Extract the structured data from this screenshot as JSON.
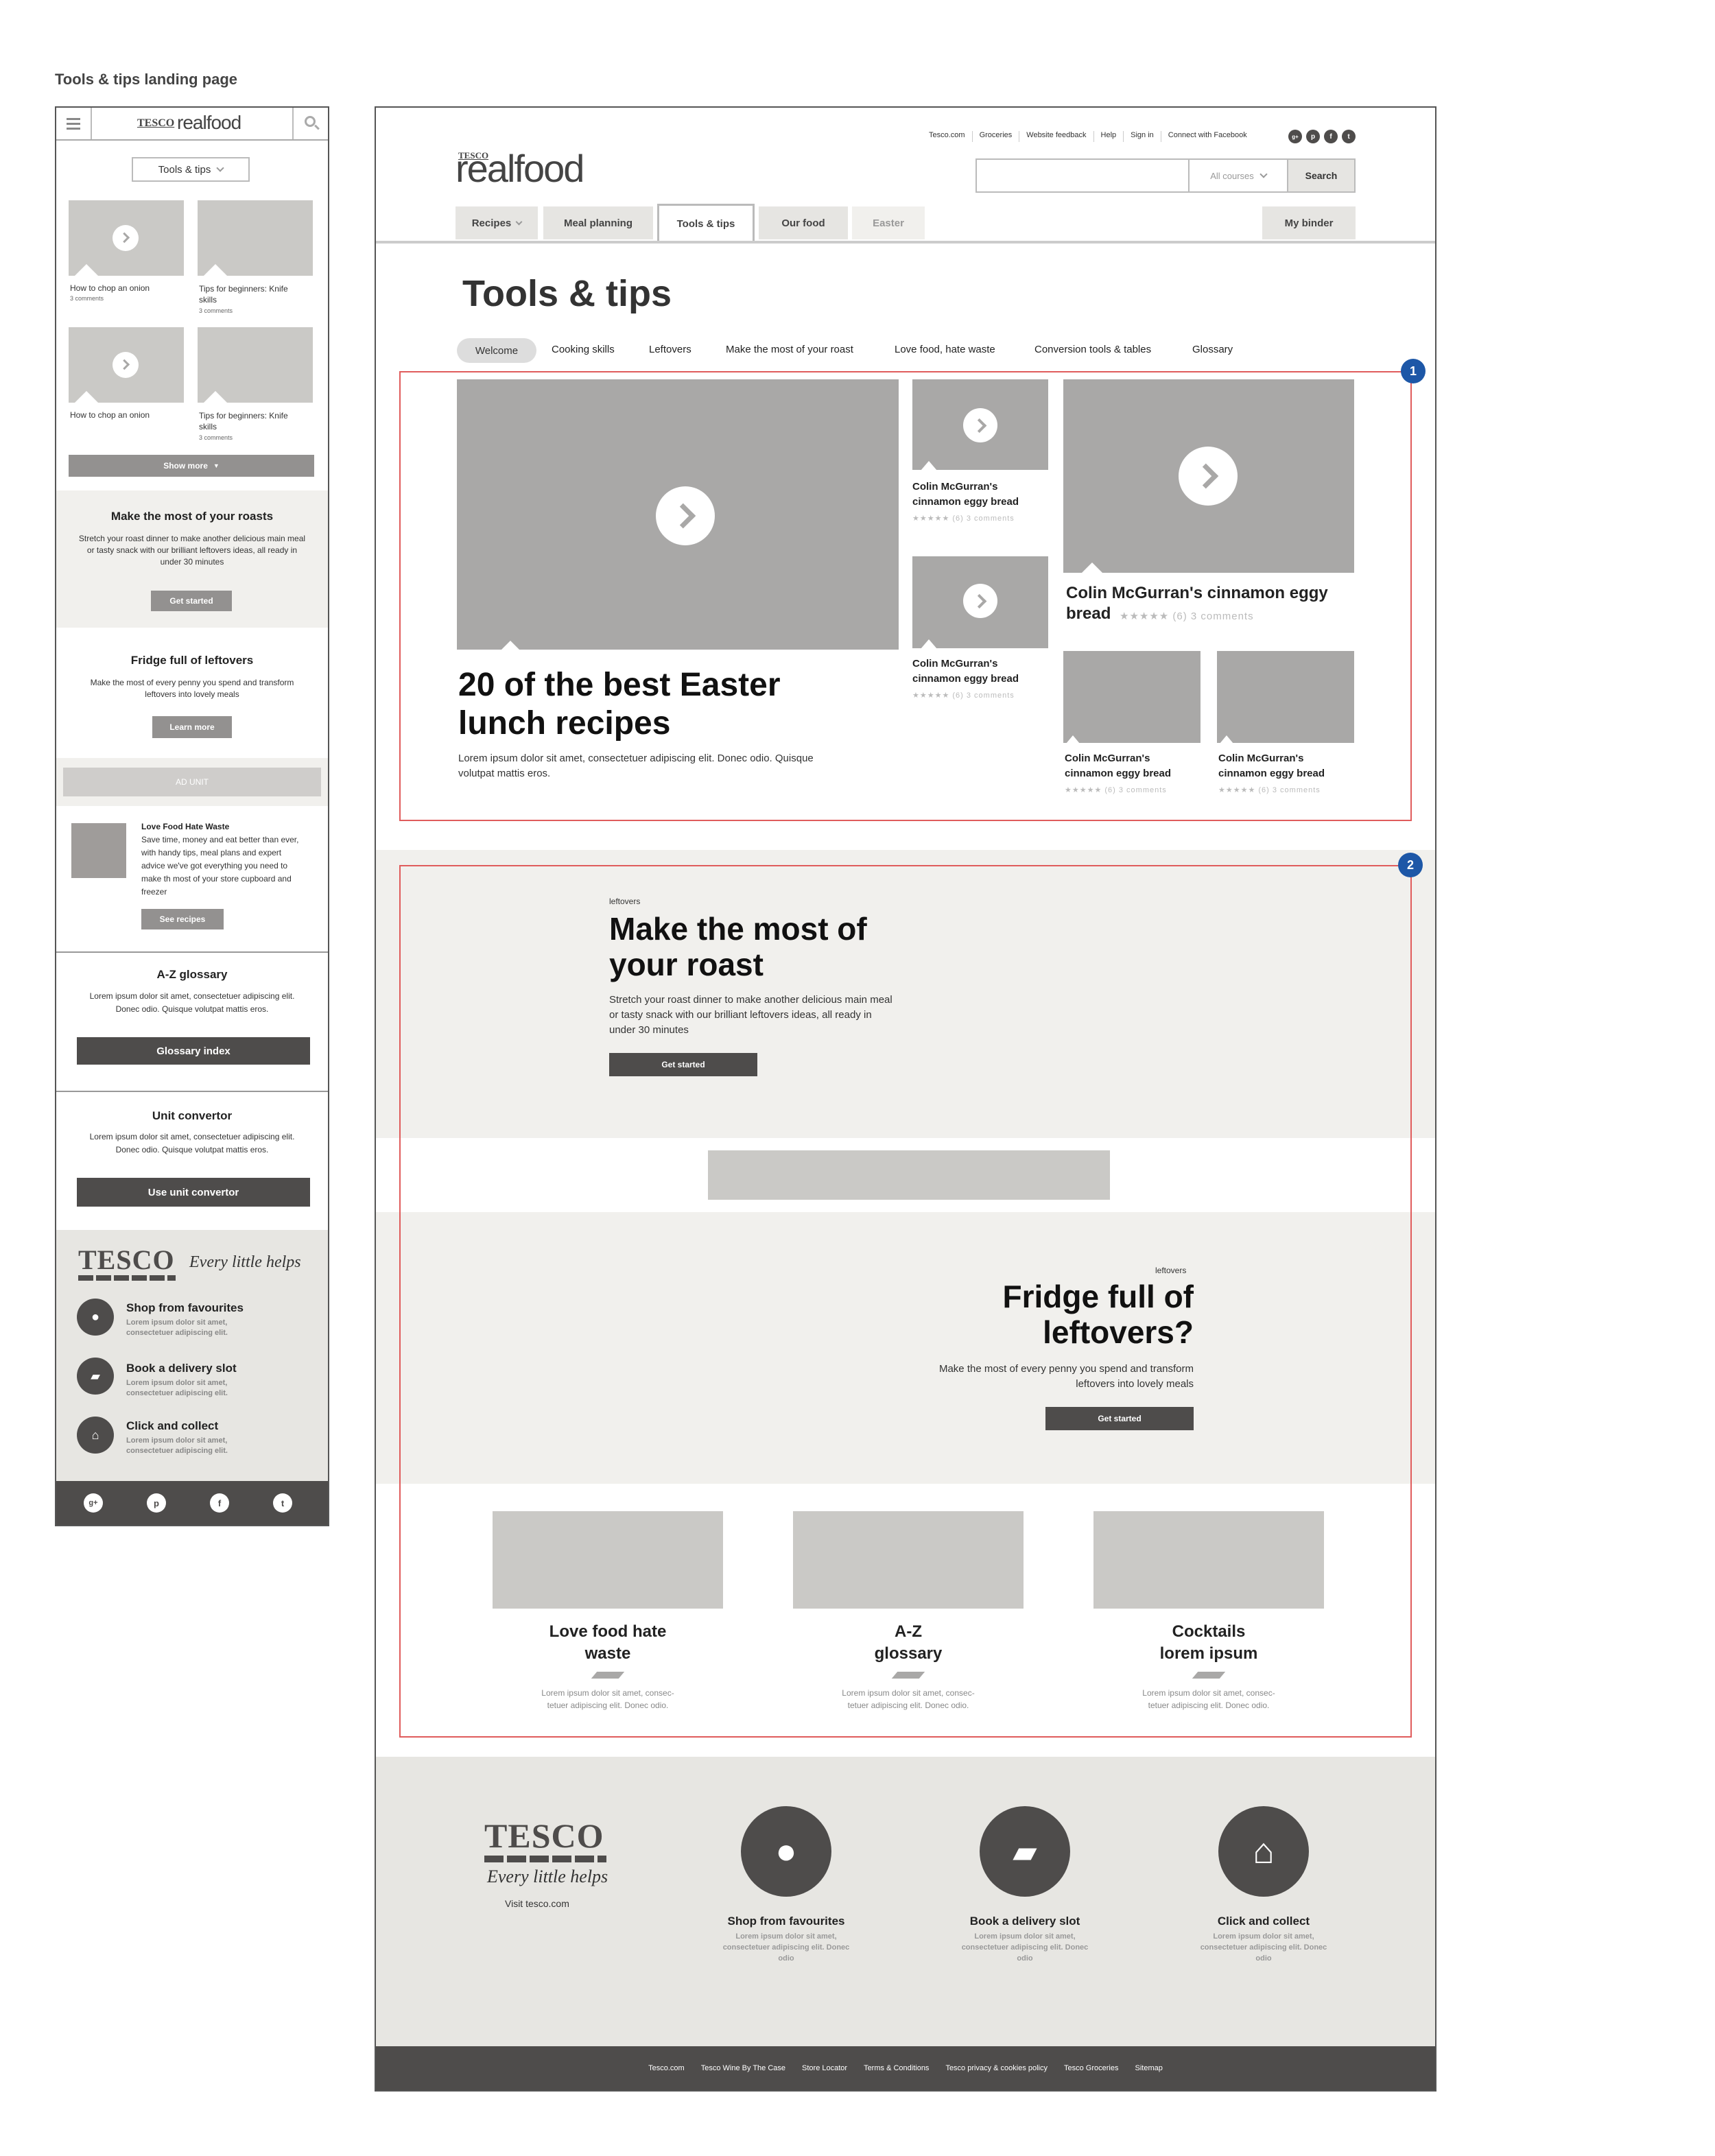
{
  "page_label": "Tools & tips landing page",
  "mobile": {
    "logo": {
      "tesco": "TESCO",
      "realfood": "realfood"
    },
    "dropdown_label": "Tools & tips",
    "tiles": [
      {
        "caption": "How to chop an onion",
        "comments": "3 comments"
      },
      {
        "caption": "Tips for beginners: Knife skills",
        "comments": "3 comments"
      },
      {
        "caption": "How to chop an onion",
        "comments": ""
      },
      {
        "caption": "Tips for beginners: Knife skills",
        "comments": "3 comments"
      }
    ],
    "show_more": "Show more",
    "roasts": {
      "title": "Make the most of your roasts",
      "body": "Stretch your roast dinner to make another delicious main meal or tasty snack with our brilliant leftovers ideas, all ready in under 30 minutes",
      "button": "Get started"
    },
    "fridge": {
      "title": "Fridge full of leftovers",
      "body": "Make the most of every penny you spend and transform leftovers into lovely meals",
      "button": "Learn more"
    },
    "ad_unit": "AD UNIT",
    "lfhw": {
      "title": "Love Food Hate Waste",
      "body": "Save time, money and eat better than ever, with handy tips, meal plans and expert advice we've got everything you need to make th most of your store cupboard and freezer",
      "button": "See recipes"
    },
    "glossary": {
      "title": "A-Z glossary",
      "body": "Lorem ipsum dolor sit amet, consectetuer adipiscing elit. Donec odio. Quisque volutpat mattis eros.",
      "button": "Glossary index"
    },
    "unit": {
      "title": "Unit convertor",
      "body": "Lorem ipsum dolor sit amet, consectetuer adipiscing elit. Donec odio. Quisque volutpat mattis eros.",
      "button": "Use unit convertor"
    },
    "footer": {
      "tesco": "TESCO",
      "tagline": "Every little helps",
      "items": [
        {
          "title": "Shop from favourites",
          "body": "Lorem ipsum dolor sit amet, consectetuer adipiscing elit."
        },
        {
          "title": "Book a delivery slot",
          "body": "Lorem ipsum dolor sit amet, consectetuer adipiscing elit."
        },
        {
          "title": "Click and collect",
          "body": "Lorem ipsum dolor sit amet, consectetuer adipiscing elit."
        }
      ],
      "social": [
        "g+",
        "p",
        "f",
        "t"
      ]
    }
  },
  "desktop": {
    "top_links": [
      "Tesco.com",
      "Groceries",
      "Website feedback",
      "Help",
      "Sign in",
      "Connect with Facebook"
    ],
    "social": [
      "g+",
      "p",
      "f",
      "t"
    ],
    "logo": {
      "tesco": "TESCO",
      "realfood": "realfood"
    },
    "search": {
      "placeholder": "",
      "select": "All courses",
      "button": "Search"
    },
    "nav": [
      "Recipes",
      "Meal planning",
      "Tools & tips",
      "Our food",
      "Easter"
    ],
    "my_binder": "My binder",
    "page_title": "Tools & tips",
    "subnav": [
      "Welcome",
      "Cooking skills",
      "Leftovers",
      "Make the most of your roast",
      "Love food, hate waste",
      "Conversion tools & tables",
      "Glossary"
    ],
    "hero": {
      "title_l1": "20 of the best Easter",
      "title_l2": "lunch recipes",
      "body_l1": "Lorem ipsum dolor sit amet, consectetuer adipiscing elit. Donec odio. Quisque",
      "body_l2": "volutpat mattis eros."
    },
    "small_cards": [
      {
        "title_l1": "Colin McGurran's",
        "title_l2": "cinnamon eggy bread",
        "meta": "★★★★★ (6)  3 comments"
      },
      {
        "title_l1": "Colin McGurran's",
        "title_l2": "cinnamon eggy bread",
        "meta": "★★★★★ (6)  3 comments"
      }
    ],
    "big_card": {
      "title_l1": "Colin McGurran's cinnamon eggy",
      "title_l2": "bread",
      "meta": "★★★★★ (6)  3 comments"
    },
    "bottom_cards": [
      {
        "title_l1": "Colin McGurran's",
        "title_l2": "cinnamon eggy bread",
        "meta": "★★★★★ (6)  3 comments"
      },
      {
        "title_l1": "Colin McGurran's",
        "title_l2": "cinnamon eggy bread",
        "meta": "★★★★★ (6)  3 comments"
      }
    ],
    "annotations": [
      "1",
      "2"
    ],
    "roast": {
      "kicker": "leftovers",
      "title_l1": "Make the most of",
      "title_l2": "your roast",
      "body_l1": "Stretch your roast dinner to make another delicious main meal",
      "body_l2": "or tasty snack with our brilliant leftovers ideas, all ready in",
      "body_l3": "under 30 minutes",
      "button": "Get started"
    },
    "fridge": {
      "kicker": "leftovers",
      "title_l1": "Fridge full of",
      "title_l2": "leftovers?",
      "body_l1": "Make the most of every penny you spend and transform",
      "body_l2": "leftovers into lovely meals",
      "button": "Get started"
    },
    "features": [
      {
        "title_l1": "Love food hate",
        "title_l2": "waste",
        "body_l1": "Lorem ipsum dolor sit amet, consec-",
        "body_l2": "tetuer adipiscing elit. Donec odio."
      },
      {
        "title_l1": "A-Z",
        "title_l2": "glossary",
        "body_l1": "Lorem ipsum dolor sit amet, consec-",
        "body_l2": "tetuer adipiscing elit. Donec odio."
      },
      {
        "title_l1": "Cocktails",
        "title_l2": "lorem ipsum",
        "body_l1": "Lorem ipsum dolor sit amet, consec-",
        "body_l2": "tetuer adipiscing elit. Donec odio."
      }
    ],
    "footer": {
      "tesco": "TESCO",
      "tagline": "Every little helps",
      "visit": "Visit tesco.com",
      "items": [
        {
          "title": "Shop from favourites",
          "body_l1": "Lorem ipsum dolor sit amet,",
          "body_l2": "consectetuer adipiscing elit. Donec",
          "body_l3": "odio"
        },
        {
          "title": "Book a delivery slot",
          "body_l1": "Lorem ipsum dolor sit amet,",
          "body_l2": "consectetuer adipiscing elit. Donec",
          "body_l3": "odio"
        },
        {
          "title": "Click and collect",
          "body_l1": "Lorem ipsum dolor sit amet,",
          "body_l2": "consectetuer adipiscing elit. Donec",
          "body_l3": "odio"
        }
      ],
      "links": [
        "Tesco.com",
        "Tesco Wine By The Case",
        "Store Locator",
        "Terms & Conditions",
        "Tesco privacy & cookies policy",
        "Tesco Groceries",
        "Sitemap"
      ]
    }
  }
}
